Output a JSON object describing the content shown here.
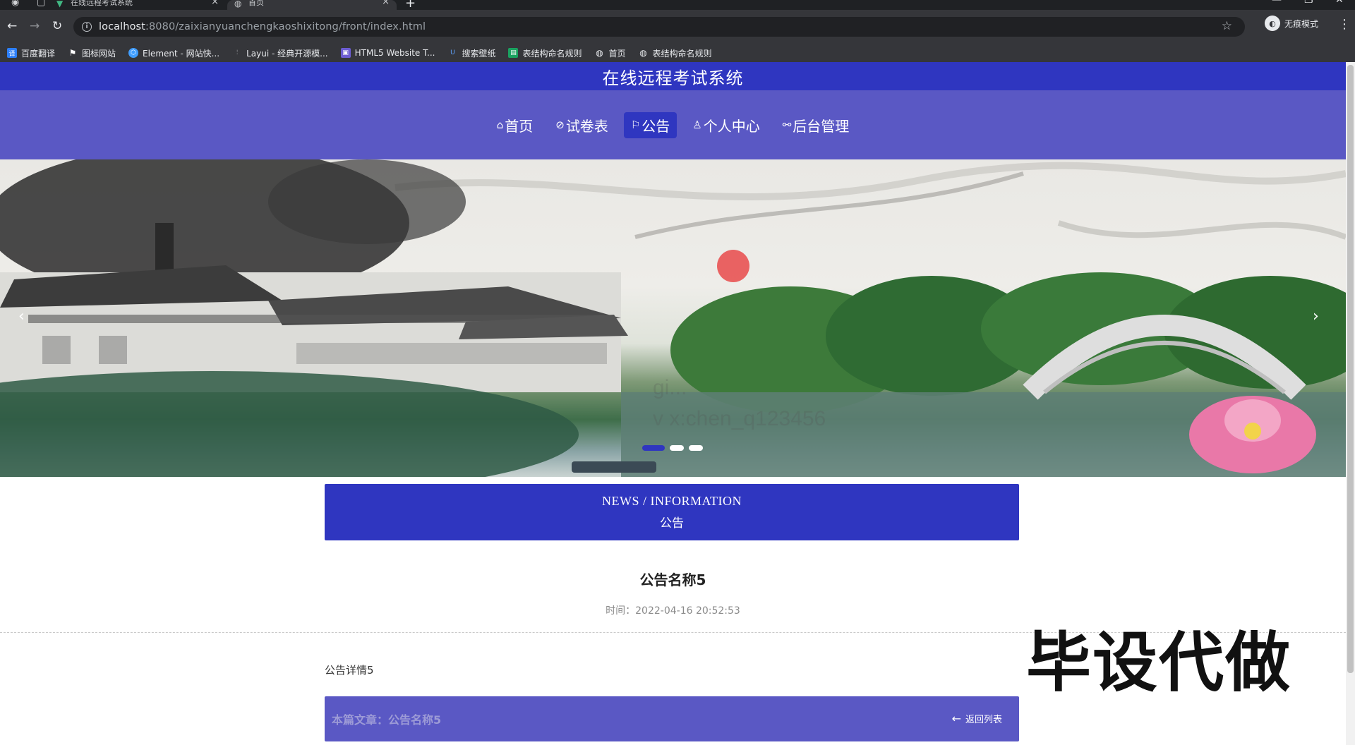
{
  "browser": {
    "tabs": [
      {
        "title": "在线远程考试系统",
        "active": false
      },
      {
        "title": "首页",
        "active": true
      }
    ],
    "url_host": "localhost",
    "url_rest": ":8080/zaixianyuanchengkaoshixitong/front/index.html",
    "profile_label": "无痕模式",
    "bookmarks": [
      {
        "label": "百度翻译",
        "icon": "baidu-translate-icon",
        "color": "#2d7ff9"
      },
      {
        "label": "图标网站",
        "icon": "flag-icon",
        "color": "#444444"
      },
      {
        "label": "Element - 网站快...",
        "icon": "element-icon",
        "color": "#409eff"
      },
      {
        "label": "Layui - 经典开源模...",
        "icon": "layui-icon",
        "color": "#009688"
      },
      {
        "label": "HTML5 Website T...",
        "icon": "html5-icon",
        "color": "#6d5dd3"
      },
      {
        "label": "搜索壁纸",
        "icon": "wallpaper-icon",
        "color": "#3b7bd8"
      },
      {
        "label": "表结构命名规则",
        "icon": "sheet-icon",
        "color": "#1aa260"
      },
      {
        "label": "首页",
        "icon": "globe-icon",
        "color": "#5f6368"
      },
      {
        "label": "表结构命名规则",
        "icon": "globe-icon",
        "color": "#5f6368"
      }
    ]
  },
  "site": {
    "title": "在线远程考试系统",
    "nav": [
      {
        "label": "首页",
        "icon": "home-icon",
        "active": false
      },
      {
        "label": "试卷表",
        "icon": "tag-icon",
        "active": false
      },
      {
        "label": "公告",
        "icon": "flag-icon",
        "active": true
      },
      {
        "label": "个人中心",
        "icon": "user-icon",
        "active": false
      },
      {
        "label": "后台管理",
        "icon": "link-icon",
        "active": false
      }
    ],
    "banner": {
      "watermark_line1": "gi...",
      "watermark_line2": "v x:chen_q123456",
      "slide_count": 3,
      "active_slide": 1
    }
  },
  "news": {
    "heading_en": "NEWS / INFORMATION",
    "heading_cn": "公告"
  },
  "article": {
    "title": "公告名称5",
    "time_label": "时间：",
    "time_value": "2022-04-16 20:52:53",
    "body": "公告详情5",
    "current_label": "本篇文章：公告名称5",
    "back_label": "返回列表"
  },
  "overlay": {
    "text": "毕设代做"
  }
}
